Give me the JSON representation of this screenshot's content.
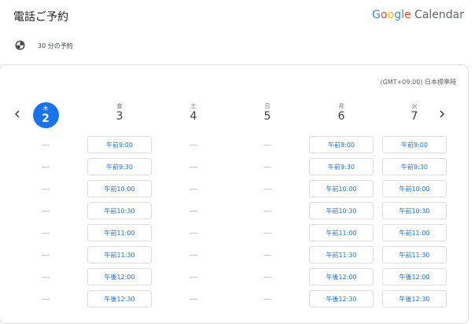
{
  "header": {
    "title": "電話ご予約",
    "brand_google": [
      "G",
      "o",
      "o",
      "g",
      "l",
      "e"
    ],
    "brand_product": "Calendar"
  },
  "duration": {
    "icon": "clock-icon",
    "text": "30 分の予約"
  },
  "timezone": "(GMT+09:00) 日本標準時",
  "nav": {
    "prev_icon": "chevron-left-icon",
    "next_icon": "chevron-right-icon"
  },
  "days": [
    {
      "dow": "木",
      "num": "2",
      "today": true,
      "slots": []
    },
    {
      "dow": "金",
      "num": "3",
      "today": false,
      "slots": [
        "午前9:00",
        "午前9:30",
        "午前10:00",
        "午前10:30",
        "午前11:00",
        "午前11:30",
        "午後12:00",
        "午後12:30"
      ]
    },
    {
      "dow": "土",
      "num": "4",
      "today": false,
      "slots": []
    },
    {
      "dow": "日",
      "num": "5",
      "today": false,
      "slots": []
    },
    {
      "dow": "月",
      "num": "6",
      "today": false,
      "slots": [
        "午前9:00",
        "午前9:30",
        "午前10:00",
        "午前10:30",
        "午前11:00",
        "午前11:30",
        "午後12:00",
        "午後12:30"
      ]
    },
    {
      "dow": "火",
      "num": "7",
      "today": false,
      "slots": [
        "午前9:00",
        "午前9:30",
        "午前10:00",
        "午前10:30",
        "午前11:00",
        "午前11:30",
        "午後12:00",
        "午後12:30"
      ]
    }
  ],
  "empty_marker": "—",
  "colors": {
    "accent": "#1a73e8",
    "border": "#dadce0",
    "muted": "#5f6368"
  }
}
